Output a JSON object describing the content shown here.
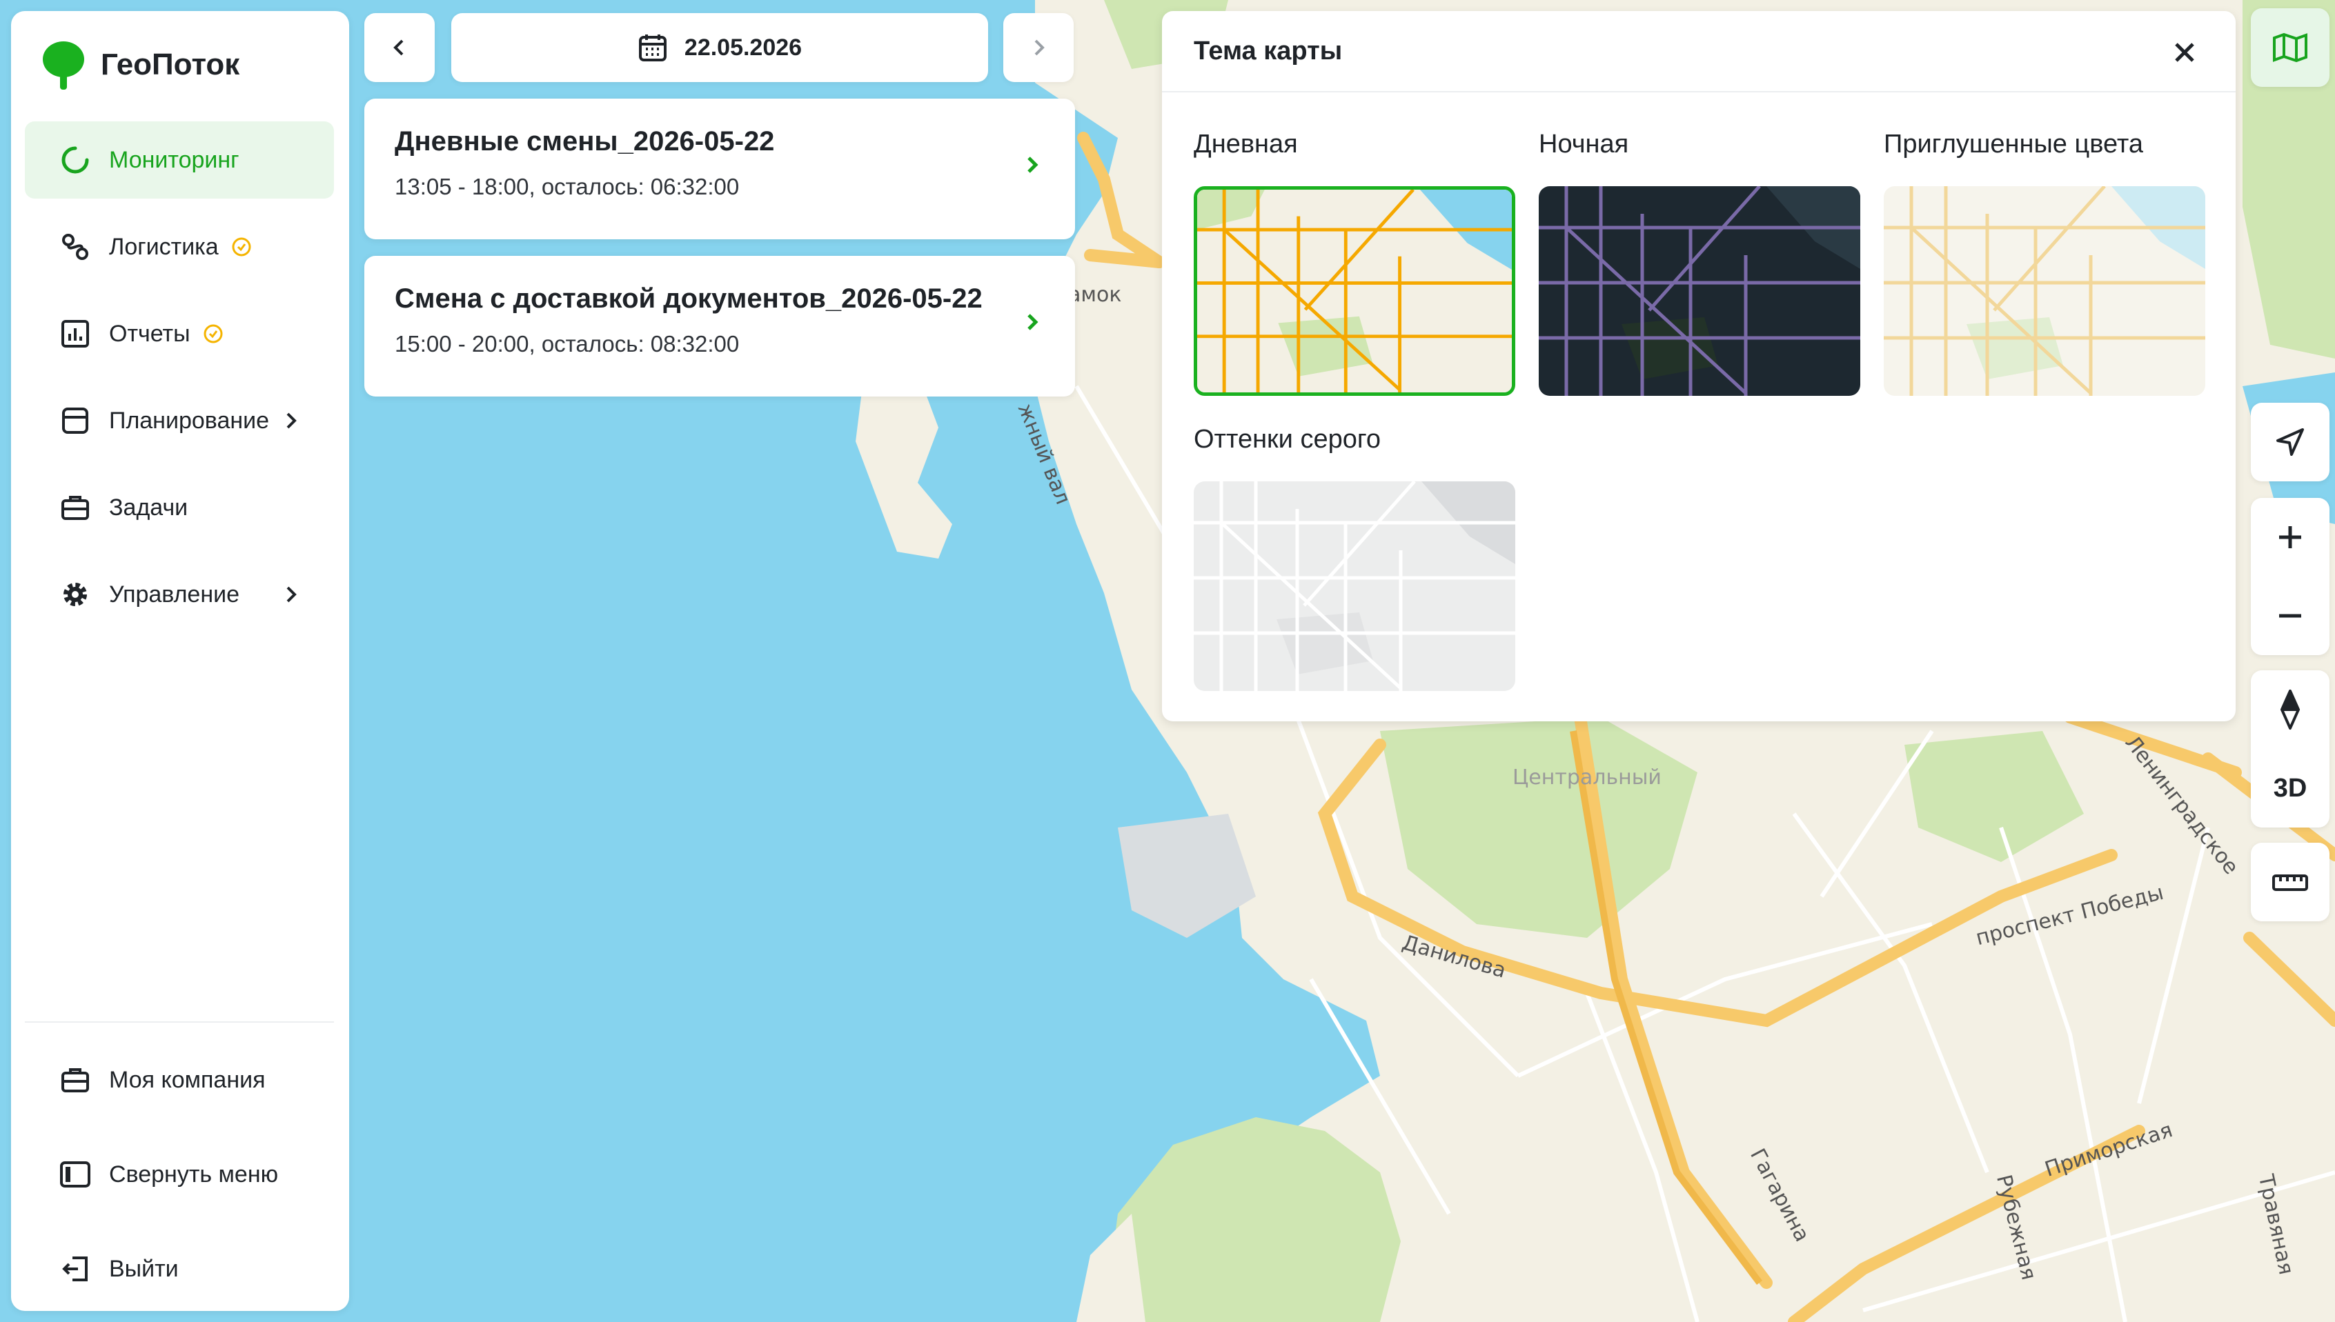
{
  "app": {
    "name": "ГеоПоток"
  },
  "sidebar": {
    "items": [
      {
        "label": "Мониторинг",
        "icon": "spinner-icon",
        "active": true
      },
      {
        "label": "Логистика",
        "icon": "route-icon",
        "badge": "clock-badge-icon"
      },
      {
        "label": "Отчеты",
        "icon": "chart-icon",
        "badge": "clock-badge-icon"
      },
      {
        "label": "Планирование",
        "icon": "calendar-box-icon",
        "chevron": true
      },
      {
        "label": "Задачи",
        "icon": "briefcase-icon"
      },
      {
        "label": "Управление",
        "icon": "gear-icon",
        "chevron": true
      }
    ],
    "bottom": [
      {
        "label": "Моя компания",
        "icon": "briefcase-icon"
      },
      {
        "label": "Свернуть меню",
        "icon": "sidebar-collapse-icon"
      },
      {
        "label": "Выйти",
        "icon": "logout-icon"
      }
    ]
  },
  "date_bar": {
    "date": "22.05.2026"
  },
  "shifts": [
    {
      "title": "Дневные смены_2026-05-22",
      "subtitle": "13:05 - 18:00, осталось: 06:32:00"
    },
    {
      "title": "Смена с доставкой документов_2026-05-22",
      "subtitle": "15:00 - 20:00, осталось: 08:32:00"
    }
  ],
  "theme_panel": {
    "title": "Тема карты",
    "options": [
      {
        "label": "Дневная",
        "selected": true
      },
      {
        "label": "Ночная",
        "selected": false
      },
      {
        "label": "Приглушенные цвета",
        "selected": false
      },
      {
        "label": "Оттенки серого",
        "selected": false
      }
    ]
  },
  "map_labels": {
    "district": "Центральный",
    "street_danilova": "Данилова",
    "street_gagarina": "Гагарина",
    "street_pobedy": "проспект Победы",
    "street_primorskaya": "Приморская",
    "street_rubezhnaya": "Рубежная",
    "street_travyanaya": "Травяная",
    "street_leningradskoe": "Ленинградское",
    "street_val": "жный вал",
    "street_zamok": "амок"
  },
  "controls": {
    "threed_label": "3D"
  },
  "colors": {
    "accent": "#18a41e",
    "water": "#86d3ee",
    "land": "#f3f0e4",
    "park": "#cfe6b2",
    "road": "#f7c96a"
  }
}
